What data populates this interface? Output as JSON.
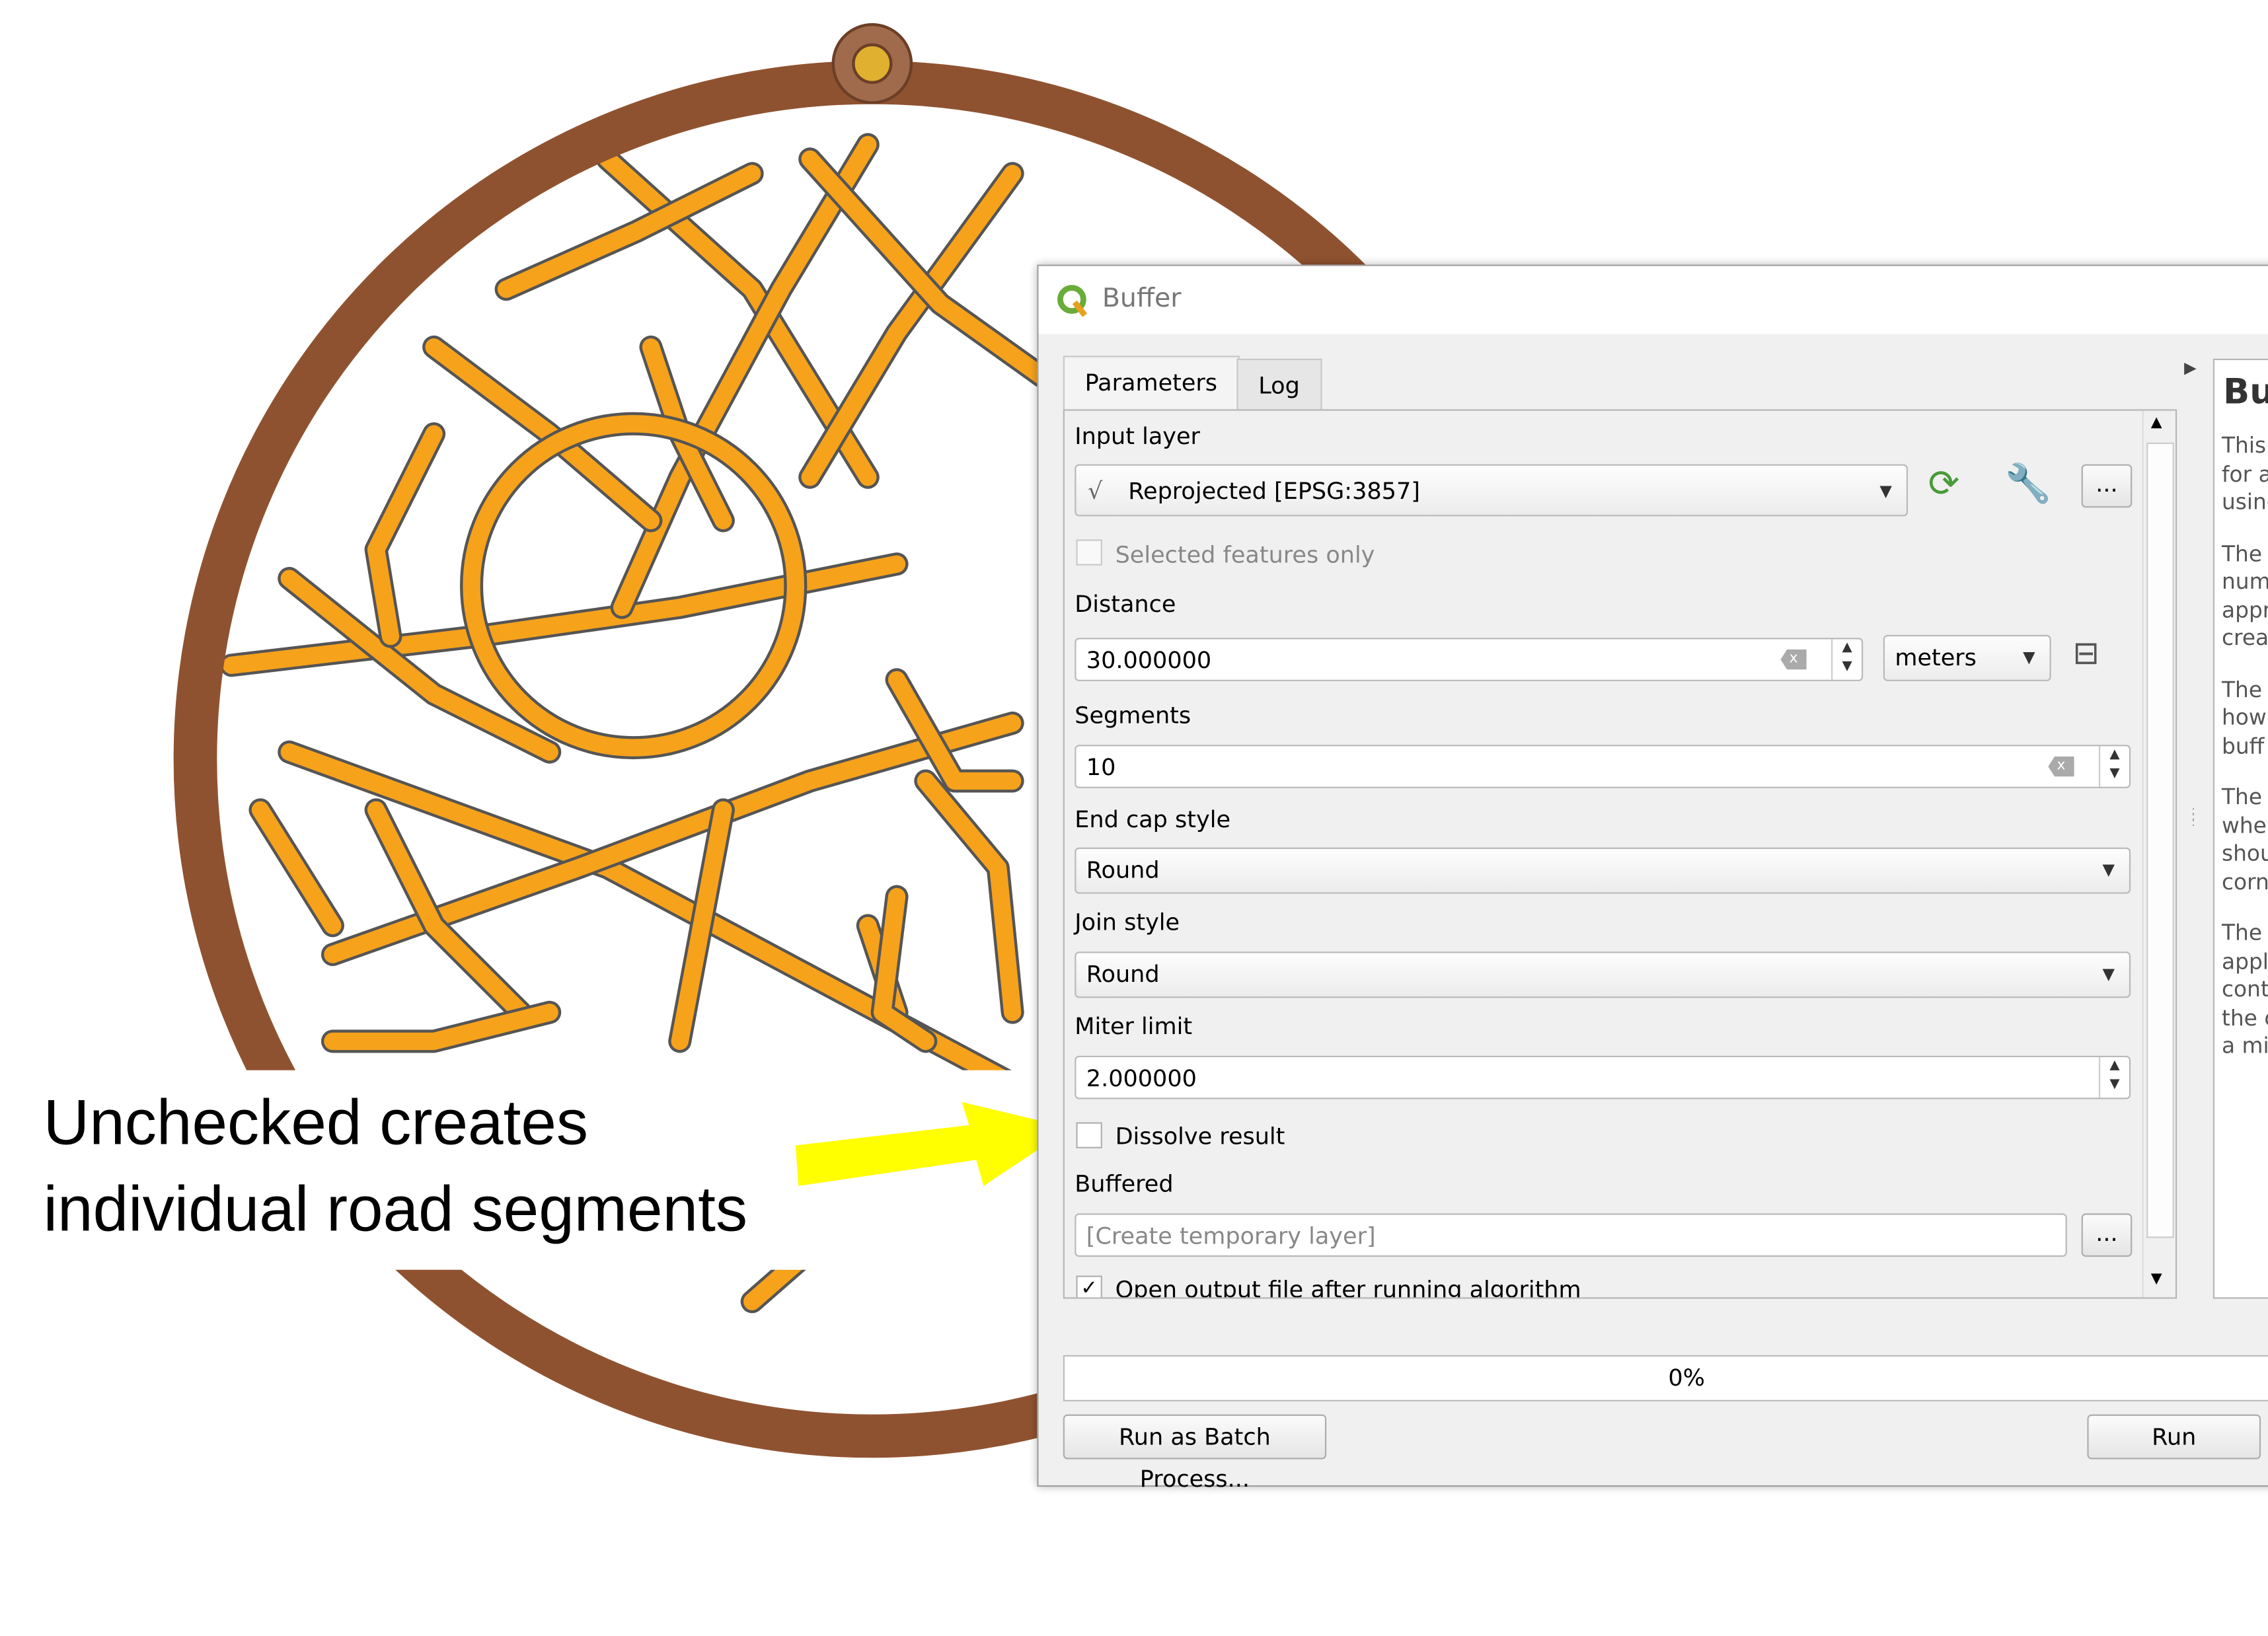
{
  "annotation": {
    "line1": "Unchecked creates",
    "line2": "individual road segments",
    "arrow_color": "#ffff00"
  },
  "map": {
    "ring_color": "#8f5230",
    "road_color": "#f7a21b",
    "road_outline": "#555555"
  },
  "dialog": {
    "title": "Buffer",
    "tabs": [
      {
        "label": "Parameters",
        "active": true
      },
      {
        "label": "Log",
        "active": false
      }
    ],
    "input_layer": {
      "label": "Input layer",
      "value": "Reprojected [EPSG:3857]",
      "more_label": "..."
    },
    "selected_only": {
      "label": "Selected features only",
      "checked": false
    },
    "distance": {
      "label": "Distance",
      "value": "30.000000",
      "unit": "meters"
    },
    "segments": {
      "label": "Segments",
      "value": "10"
    },
    "end_cap": {
      "label": "End cap style",
      "value": "Round"
    },
    "join_style": {
      "label": "Join style",
      "value": "Round"
    },
    "miter_limit": {
      "label": "Miter limit",
      "value": "2.000000"
    },
    "dissolve": {
      "label": "Dissolve result",
      "checked": false
    },
    "buffered": {
      "label": "Buffered",
      "placeholder": "[Create temporary layer]",
      "more_label": "..."
    },
    "open_output": {
      "label": "Open output file after running algorithm",
      "checked": true
    },
    "help": {
      "heading": "Bu",
      "paragraphs": [
        [
          "This",
          "for a",
          "using"
        ],
        [
          "The",
          "numb",
          "appr",
          "crea"
        ],
        [
          "The",
          "how",
          "buff"
        ],
        [
          "The",
          "whe",
          "shou",
          "corn"
        ],
        [
          "The",
          "appl",
          "cont",
          "the c",
          "a mit"
        ]
      ]
    },
    "progress": {
      "value": 0,
      "label": "0%"
    },
    "batch_label": "Run as Batch Process...",
    "run_label": "Run"
  }
}
